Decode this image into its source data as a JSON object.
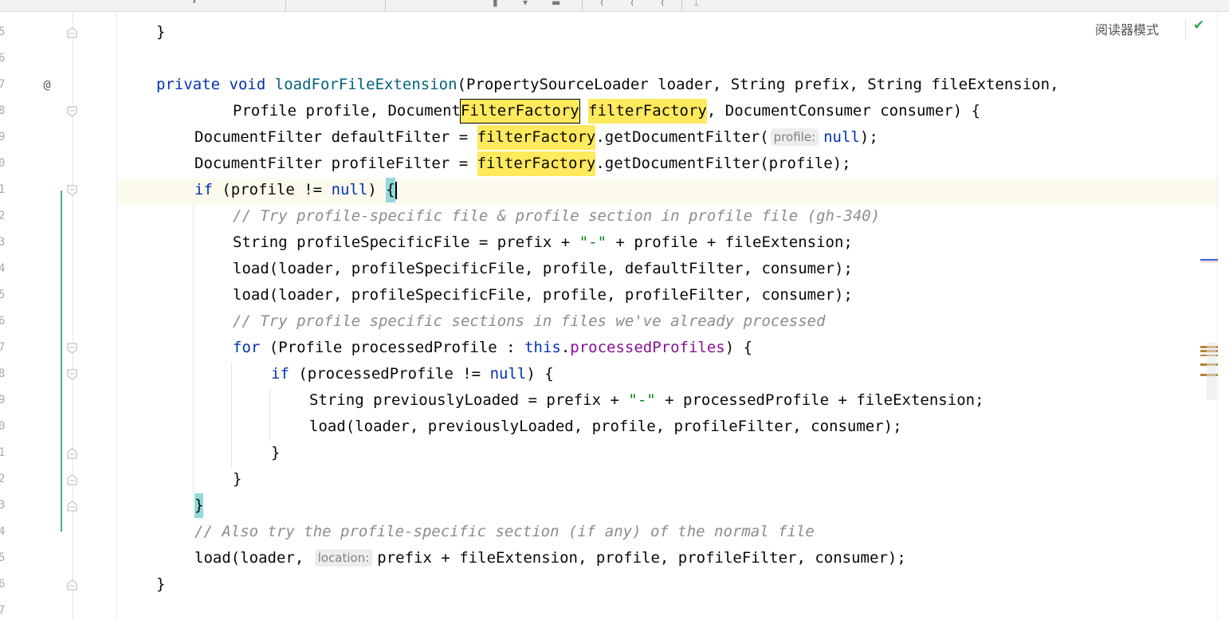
{
  "window": {
    "reader_mode_label": "阅读器模式",
    "inspection_status": "no-problems"
  },
  "gutter": {
    "line_numbers": [
      "5",
      "6",
      "7",
      "8",
      "9",
      "0",
      "1",
      "2",
      "3",
      "4",
      "5",
      "6",
      "7",
      "8",
      "9",
      "0",
      "1",
      "2",
      "3",
      "4",
      "5",
      "6",
      "7"
    ],
    "annotation_symbol": "@"
  },
  "editor": {
    "caret_line_index": 6,
    "line_top_brace": "}",
    "line_signature_1": {
      "kw_private": "private",
      "kw_void": "void",
      "method": "loadForFileExtension",
      "params": "(PropertySourceLoader loader, String prefix, String fileExtension,"
    },
    "line_signature_2": {
      "before": "Profile profile, Document",
      "type_highlight": "FilterFactory",
      "param_highlight": "filterFactory",
      "after": ", DocumentConsumer consumer) {"
    },
    "line_default_filter": {
      "before": "DocumentFilter defaultFilter = ",
      "var": "filterFactory",
      "call": ".getDocumentFilter(",
      "hint": "profile:",
      "arg": "null",
      "end": ");"
    },
    "line_profile_filter": {
      "before": "DocumentFilter profileFilter = ",
      "var": "filterFactory",
      "rest": ".getDocumentFilter(profile);"
    },
    "line_if_profile": {
      "kw": "if",
      "mid": " (profile != ",
      "null": "null",
      "close": ") ",
      "brace": "{"
    },
    "line_comment_1": "// Try profile-specific file & profile section in profile file (gh-340)",
    "line_profile_specific": {
      "before": "String profileSpecificFile = prefix + ",
      "str": "\"-\"",
      "after": " + profile + fileExtension;"
    },
    "line_load_default": "load(loader, profileSpecificFile, profile, defaultFilter, consumer);",
    "line_load_profile": "load(loader, profileSpecificFile, profile, profileFilter, consumer);",
    "line_comment_2": "// Try profile specific sections in files we've already processed",
    "line_for": {
      "kw": "for",
      "mid": " (Profile processedProfile : ",
      "this": "this",
      "dot": ".",
      "field": "processedProfiles",
      "end": ") {"
    },
    "line_if_processed": {
      "kw": "if",
      "mid": " (processedProfile != ",
      "null": "null",
      "end": ") {"
    },
    "line_previously": {
      "before": "String previouslyLoaded = prefix + ",
      "str": "\"-\"",
      "after": " + processedProfile + fileExtension;"
    },
    "line_load_previously": "load(loader, previouslyLoaded, profile, profileFilter, consumer);",
    "close_brace": "}",
    "line_comment_3": "// Also try the profile-specific section (if any) of the normal file",
    "line_load_final": {
      "before": "load(loader, ",
      "hint": "location:",
      "after": "prefix + fileExtension, profile, profileFilter, consumer);"
    }
  },
  "colors": {
    "keyword": "#0033b3",
    "method_decl": "#00627a",
    "field": "#871094",
    "string": "#067d17",
    "comment": "#8c8c8c",
    "identifier_highlight": "#ffe95c",
    "brace_match": "#93d9d9",
    "caret_row": "#fcfaed",
    "vcs_change": "#55a39a"
  }
}
